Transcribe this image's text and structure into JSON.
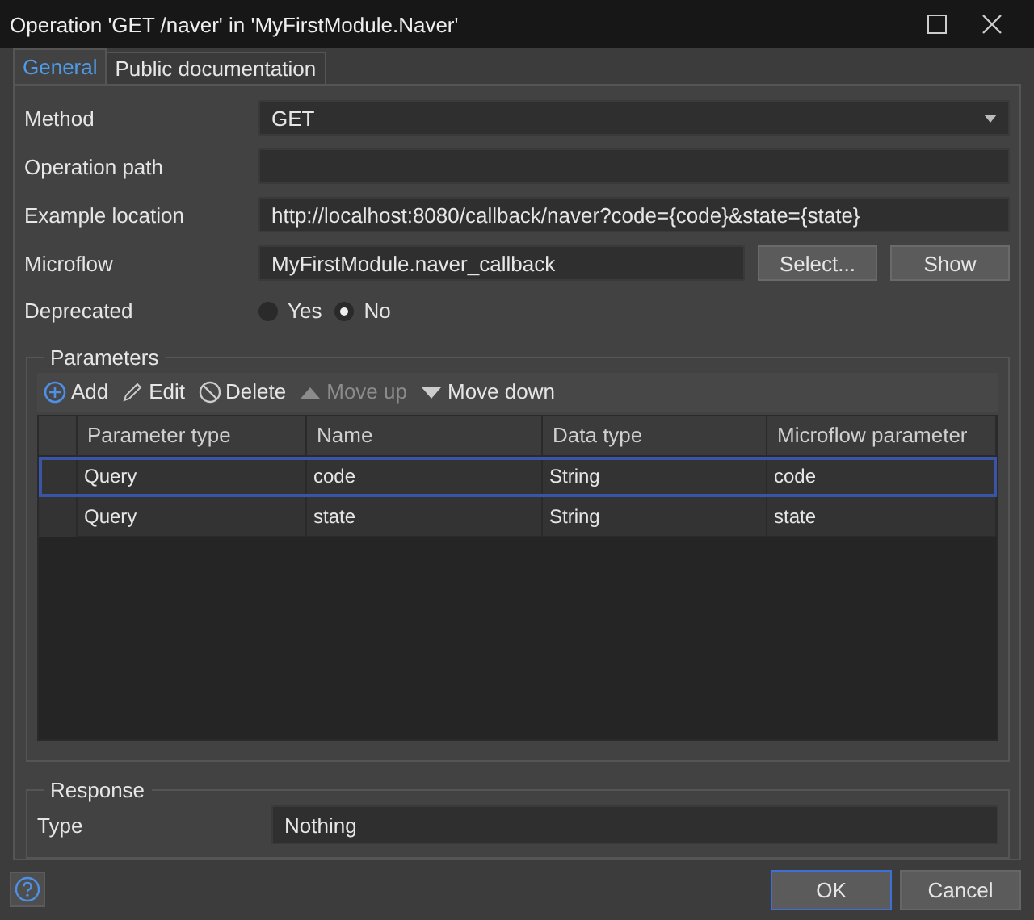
{
  "window": {
    "title": "Operation 'GET /naver' in 'MyFirstModule.Naver'"
  },
  "tabs": [
    {
      "label": "General",
      "selected": true
    },
    {
      "label": "Public documentation",
      "selected": false
    }
  ],
  "fields": [
    {
      "kind": "dropdown",
      "label": "Method",
      "value": "GET"
    },
    {
      "kind": "text",
      "label": "Operation path"
    },
    {
      "kind": "text",
      "label": "Example location",
      "value": "http://localhost:8080/callback/naver?code={code}&state={state}"
    },
    {
      "kind": "picker",
      "label": "Microflow",
      "value": "MyFirstModule.naver_callback",
      "buttons": [
        "Select...",
        "Show"
      ]
    },
    {
      "kind": "radio",
      "label": "Deprecated",
      "options": [
        {
          "label": "Yes",
          "selected": false
        },
        {
          "label": "No",
          "selected": true
        }
      ]
    }
  ],
  "parameters": {
    "title": "Parameters",
    "toolbar": [
      {
        "label": "Add",
        "disabled": false
      },
      {
        "label": "Edit",
        "disabled": false
      },
      {
        "label": "Delete",
        "disabled": false
      },
      {
        "label": "Move up",
        "disabled": true
      },
      {
        "label": "Move down",
        "disabled": false
      }
    ],
    "columns": [
      "Parameter type",
      "Name",
      "Data type",
      "Microflow parameter"
    ],
    "rows": [
      {
        "cells": [
          "Query",
          "code",
          "String",
          "code"
        ],
        "selected": true
      },
      {
        "cells": [
          "Query",
          "state",
          "String",
          "state"
        ],
        "selected": false
      }
    ]
  },
  "response": {
    "title": "Response",
    "label": "Type",
    "value": "Nothing"
  },
  "footer": {
    "buttons": [
      {
        "label": "OK",
        "default": true
      },
      {
        "label": "Cancel",
        "default": false
      }
    ]
  }
}
